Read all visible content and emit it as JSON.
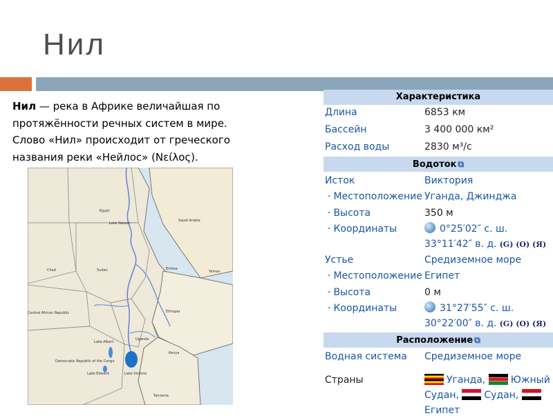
{
  "title": "Нил",
  "intro": {
    "bold": "Нил",
    "text": " — река в Африке величайшая по протяжённости речных систем в мире. Слово «Нил» происходит от греческого названия реки «Нейлос» (Νείλος)."
  },
  "map": {
    "labels": [
      "Egypt",
      "Saudi Arabia",
      "Lake Nasser",
      "Sudan",
      "Yemen",
      "Eritrea",
      "Ethiopia",
      "Chad",
      "Central African Republic",
      "Uganda",
      "Kenya",
      "Lake Victoria",
      "Democratic Republic of the Congo",
      "Tanzania",
      "Lake Albert",
      "Lake Edward"
    ]
  },
  "infobox": {
    "sections": {
      "characteristics": "Характеристика",
      "watercourse": "Водоток",
      "location": "Расположение"
    },
    "rows": {
      "length": {
        "label": "Длина",
        "value": "6853 км"
      },
      "basin": {
        "label": "Бассейн",
        "value": "3 400 000 км²"
      },
      "discharge": {
        "label": "Расход воды",
        "value": "2830 м³/с"
      },
      "source": {
        "label": "Исток",
        "value": "Виктория"
      },
      "source_location": {
        "label": "Местоположение",
        "value": "Уганда, Джинджа"
      },
      "source_height": {
        "label": "Высота",
        "value": "350 м"
      },
      "source_coords": {
        "label": "Координаты",
        "line1": "0°25′02″ с. ш.",
        "line2": "33°11′42″ в. д.",
        "extra": "(G) (O) (Я)"
      },
      "mouth": {
        "label": "Устье",
        "value": "Средиземное море"
      },
      "mouth_location": {
        "label": "Местоположение",
        "value": "Египет"
      },
      "mouth_height": {
        "label": "Высота",
        "value": "0 м"
      },
      "mouth_coords": {
        "label": "Координаты",
        "line1": "31°27′55″ с. ш.",
        "line2": "30°22′00″ в. д.",
        "extra": "(G) (O) (Я)"
      },
      "water_system": {
        "label": "Водная система",
        "value": "Средиземное море"
      },
      "countries": {
        "label": "Страны",
        "part1": "Уганда,",
        "part2": "Южный",
        "part3": "Судан,",
        "part4": "Судан,",
        "part5": "Египет"
      }
    },
    "colors": {
      "header": "#c8d8ef",
      "link": "#1a55a6"
    },
    "icons": [
      "external-link-icon",
      "globe-icon",
      "uganda-flag-icon",
      "south-sudan-flag-icon",
      "sudan-flag-icon",
      "egypt-flag-icon"
    ]
  }
}
